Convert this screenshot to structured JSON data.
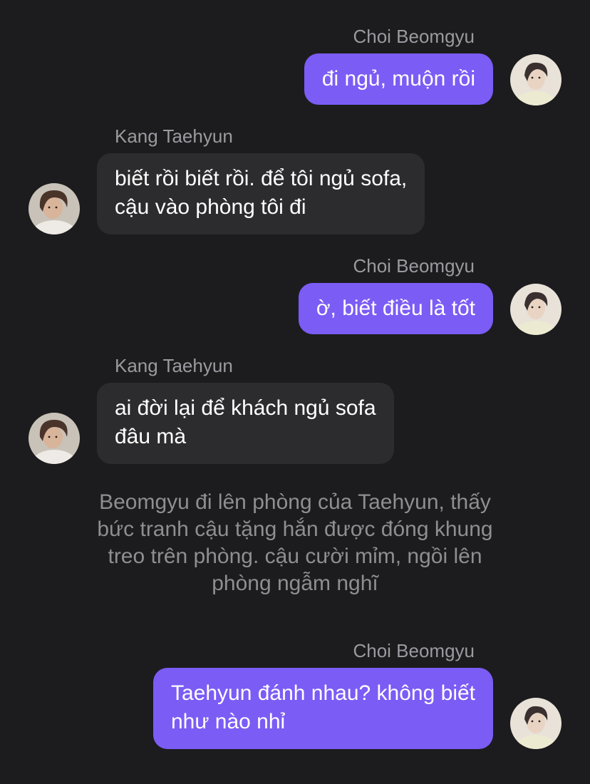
{
  "messages": [
    {
      "sender": "Choi Beomgyu",
      "side": "right",
      "lines": [
        "đi ngủ, muộn rồi"
      ]
    },
    {
      "sender": "Kang Taehyun",
      "side": "left",
      "lines": [
        "biết rồi biết rồi. để tôi ngủ sofa,",
        "cậu vào phòng tôi đi"
      ]
    },
    {
      "sender": "Choi Beomgyu",
      "side": "right",
      "lines": [
        "ờ, biết điều là tốt"
      ]
    },
    {
      "sender": "Kang Taehyun",
      "side": "left",
      "lines": [
        "ai đời lại để khách ngủ sofa",
        "đâu mà"
      ]
    },
    {
      "sender": "Choi Beomgyu",
      "side": "right",
      "lines": [
        "Taehyun đánh nhau? không biết",
        "như nào nhỉ"
      ]
    }
  ],
  "narration": [
    "Beomgyu đi lên phòng của Taehyun, thấy",
    "bức tranh cậu tặng hắn được đóng khung",
    "treo trên phòng. cậu cười mỉm, ngồi lên",
    "phòng ngẫm nghĩ"
  ],
  "colors": {
    "background": "#1c1c1e",
    "outgoing_bubble": "#7b5cf5",
    "incoming_bubble": "#2c2c2e",
    "sender_name": "#9a9aa0",
    "narration_text": "#8e8e93"
  },
  "icons": {
    "beomgyu_avatar": "avatar-photo-beomgyu",
    "taehyun_avatar": "avatar-photo-taehyun"
  }
}
